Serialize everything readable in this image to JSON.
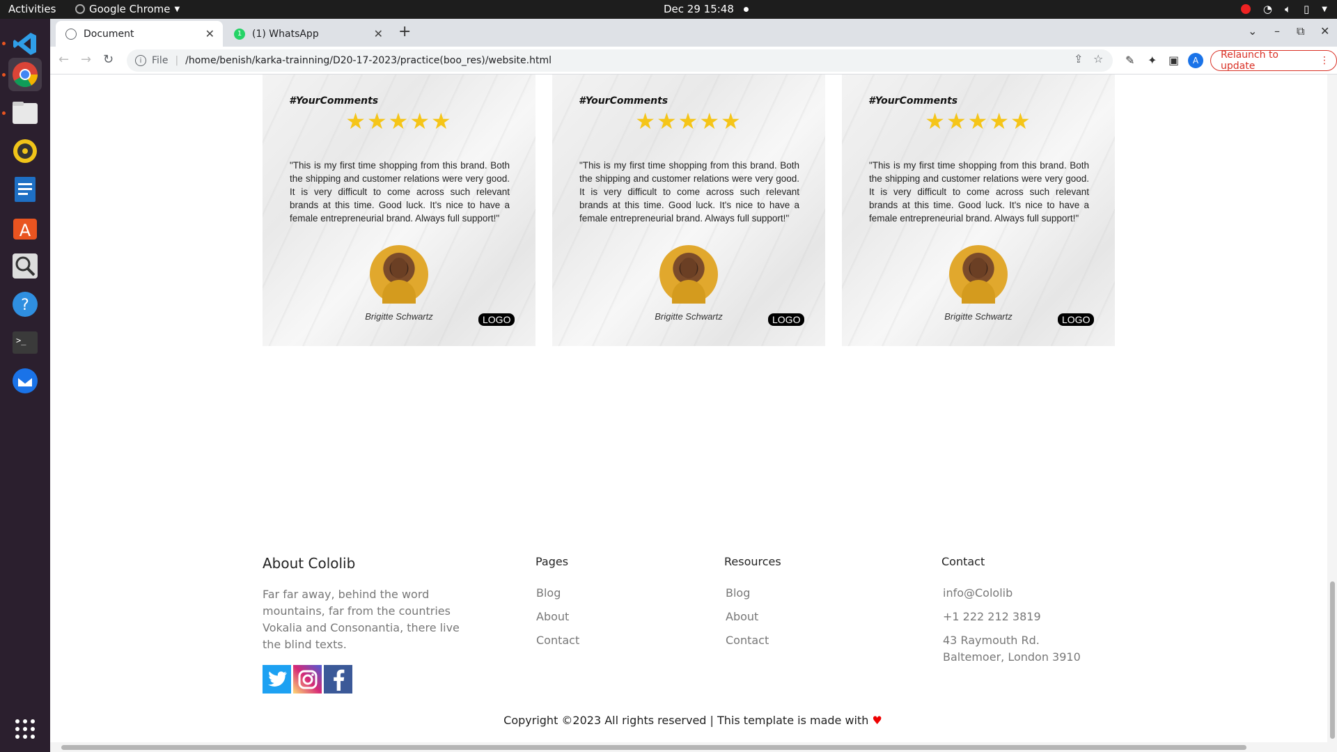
{
  "system": {
    "activities": "Activities",
    "app_name": "Google Chrome",
    "clock": "Dec 29  15:48"
  },
  "dock": [
    {
      "name": "vscode-icon"
    },
    {
      "name": "chrome-icon"
    },
    {
      "name": "files-icon"
    },
    {
      "name": "rhythmbox-icon"
    },
    {
      "name": "writer-icon"
    },
    {
      "name": "app-center-icon"
    },
    {
      "name": "magnifier-icon"
    },
    {
      "name": "help-icon"
    },
    {
      "name": "terminal-icon"
    },
    {
      "name": "thunderbird-icon"
    },
    {
      "name": "show-apps-icon"
    }
  ],
  "browser": {
    "tabs": [
      {
        "label": "Document"
      },
      {
        "label": "(1) WhatsApp"
      }
    ],
    "address_scheme": "File",
    "address_url": "/home/benish/karka-trainning/D20-17-2023/practice(boo_res)/website.html",
    "profile_initial": "A",
    "relaunch_label": "Relaunch to update"
  },
  "testimonials": [
    {
      "hashtag": "#YourComments",
      "stars": "★★★★★",
      "quote": "\"This is my first time shopping from this brand. Both the shipping and customer relations were very good. It is very difficult to come across such relevant brands at this time. Good luck. It's nice to have a female entrepreneurial brand. Always full support!\"",
      "name": "Brigitte Schwartz",
      "logo": "LOGO"
    },
    {
      "hashtag": "#YourComments",
      "stars": "★★★★★",
      "quote": "\"This is my first time shopping from this brand. Both the shipping and customer relations were very good. It is very difficult to come across such relevant brands at this time. Good luck. It's nice to have a female entrepreneurial brand. Always full support!\"",
      "name": "Brigitte Schwartz",
      "logo": "LOGO"
    },
    {
      "hashtag": "#YourComments",
      "stars": "★★★★★",
      "quote": "\"This is my first time shopping from this brand. Both the shipping and customer relations were very good. It is very difficult to come across such relevant brands at this time. Good luck. It's nice to have a female entrepreneurial brand. Always full support!\"",
      "name": "Brigitte Schwartz",
      "logo": "LOGO"
    }
  ],
  "footer": {
    "about_title": "About Cololib",
    "about_text": "Far far away, behind the word mountains, far from the countries Vokalia and Consonantia, there live the blind texts.",
    "pages_title": "Pages",
    "pages_links": [
      "Blog",
      "About",
      "Contact"
    ],
    "resources_title": "Resources",
    "resources_links": [
      "Blog",
      "About",
      "Contact"
    ],
    "contact_title": "Contact",
    "contact_email": "info@Cololib",
    "contact_phone": "+1 222 212 3819",
    "contact_address": "43 Raymouth Rd. Baltemoer, London 3910",
    "copyright": "Copyright ©2023 All rights reserved | This template is made with"
  },
  "colors": {
    "twitter": "#1da1f2",
    "instagram": "#c13584",
    "facebook": "#3b5998",
    "relaunch": "#d93025",
    "star": "#f5c518"
  }
}
